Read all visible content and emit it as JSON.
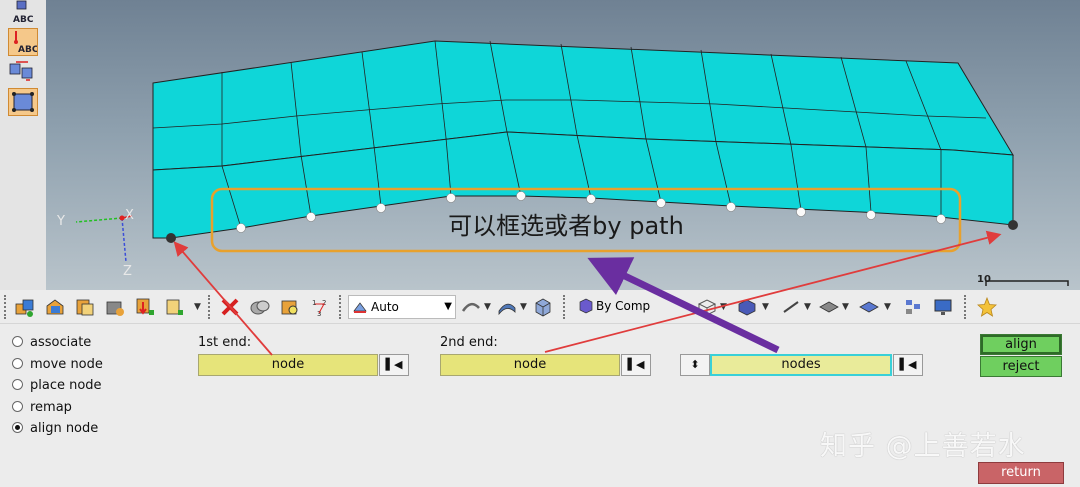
{
  "left_toolbar": {
    "items": [
      {
        "icon": "label-abc-icon",
        "text": "ABC"
      },
      {
        "icon": "node-label-abc-icon",
        "text": "ABC",
        "accent": "#e8a23a"
      },
      {
        "icon": "renumber-icon"
      },
      {
        "icon": "surface-edit-icon",
        "accent": "#e8a23a"
      }
    ]
  },
  "viewport": {
    "annotation": "可以框选或者by path",
    "axes": {
      "x": "X",
      "y": "Y",
      "z": "Z"
    },
    "scale_label": "10",
    "colors": {
      "mesh": "#0fd6d8",
      "highlight_box": "#e8a12d",
      "arrow_red": "#e03c3c",
      "arrow_purple": "#6a2ea0"
    }
  },
  "main_toolbar": {
    "element_size_value": "Auto",
    "color_mode_value": "By Comp",
    "icons": [
      "component-icon",
      "collector-icon",
      "assembly-icon",
      "load-icon",
      "loadstep-icon",
      "delete-icon",
      "mask-icon",
      "find-icon",
      "distance-icon",
      "geometry-icon",
      "surface-icon",
      "solid-icon",
      "by-comp-icon",
      "wireframe-icon",
      "shaded-icon",
      "line-icon",
      "plane-icon",
      "view-icon",
      "monitor-icon",
      "favorite-star-icon"
    ]
  },
  "panel": {
    "modes": [
      {
        "label": "associate",
        "selected": false
      },
      {
        "label": "move node",
        "selected": false
      },
      {
        "label": "place node",
        "selected": false
      },
      {
        "label": "remap",
        "selected": false
      },
      {
        "label": "align node",
        "selected": true
      }
    ],
    "first_end": {
      "label": "1st end:",
      "value": "node"
    },
    "second_end": {
      "label": "2nd end:",
      "value": "node"
    },
    "nodes": {
      "value": "nodes"
    },
    "buttons": {
      "align": "align",
      "reject": "reject",
      "return": "return"
    }
  },
  "watermark": "知乎 @上善若水"
}
